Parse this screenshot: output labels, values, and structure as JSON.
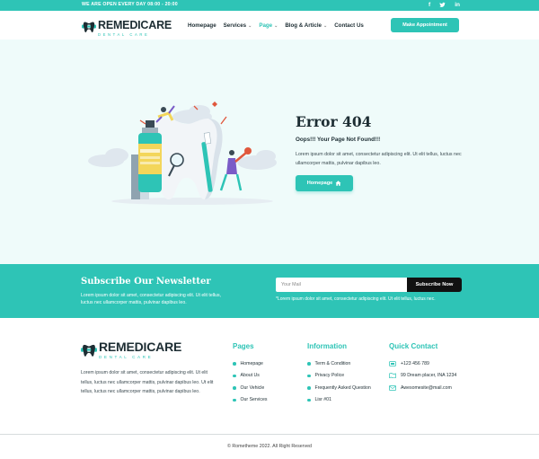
{
  "topbar": {
    "hours": "WE ARE OPEN EVERY DAY  08:00 - 20:00",
    "socials": [
      {
        "icon": "facebook-icon",
        "glyph": "f"
      },
      {
        "icon": "twitter-icon",
        "glyph": "t"
      },
      {
        "icon": "linkedin-icon",
        "glyph": "in"
      }
    ]
  },
  "brand": {
    "name": "REMEDICARE",
    "tagline": "DENTAL CARE",
    "primary_color": "#2ec4b6",
    "dark_color": "#1d2d33"
  },
  "nav": {
    "items": [
      {
        "label": "Homepage",
        "has_dropdown": false
      },
      {
        "label": "Services",
        "has_dropdown": true
      },
      {
        "label": "Page",
        "has_dropdown": true,
        "active": true
      },
      {
        "label": "Blog & Article",
        "has_dropdown": true
      },
      {
        "label": "Contact Us",
        "has_dropdown": false
      }
    ],
    "cta": "Make Appointment"
  },
  "hero": {
    "title": "Error 404",
    "subtitle": "Oops!!! Your Page Not Found!!!",
    "text": "Lorem ipsum dolor sit amet, consectetur adipiscing elit. Ut elit tellus, luctus nec ullamcorper mattis, pulvinar dapibus leo.",
    "button_label": "Homepage",
    "button_icon": "home-icon"
  },
  "newsletter": {
    "title": "Subscribe Our Newsletter",
    "text": "Lorem ipsum dolor sit amet, consectetur adipiscing elit. Ut elit tellus, luctus nec ullamcorper mattis, pulvinar dapibus leo.",
    "input_placeholder": "Your Mail",
    "button_label": "Subscribe Now",
    "note": "*Lorem ipsum dolor sit amet, consectetur adipiscing elit. Ut elit tellus, luctus nec."
  },
  "footer": {
    "about": "Lorem ipsum dolor sit amet, consectetur adipiscing elit. Ut elit tellus, luctus nec ullamcorper mattis, pulvinar dapibus leo. Ut elit tellus, luctus nec ullamcorper mattis, pulvinar dapibus leo.",
    "pages": {
      "title": "Pages",
      "items": [
        "Homepage",
        "About Us",
        "Our Vehicle",
        "Our Services"
      ]
    },
    "information": {
      "title": "Information",
      "items": [
        "Term & Condition",
        "Privacy Police",
        "Frequently Asked Question",
        "Lisr #01"
      ]
    },
    "contact": {
      "title": "Quick Contact",
      "items": [
        {
          "icon": "phone-icon",
          "text": "+123 456 789"
        },
        {
          "icon": "map-icon",
          "text": "99 Dream placer, INA 1234"
        },
        {
          "icon": "mail-icon",
          "text": "Awesomesite@mail.com"
        }
      ]
    },
    "copyright": "© Rometheme 2022. All Right Reserved"
  }
}
